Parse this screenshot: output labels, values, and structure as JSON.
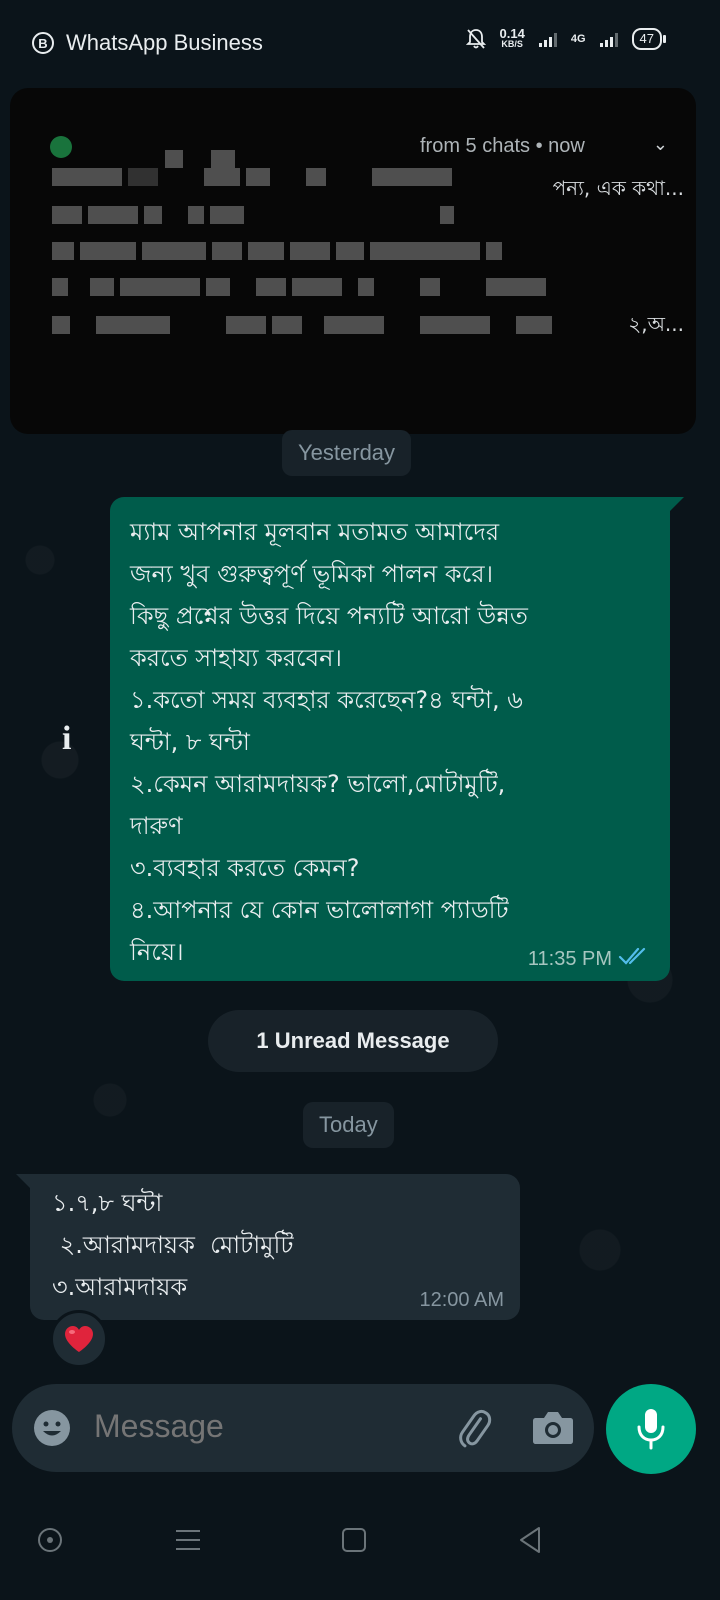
{
  "status_bar": {
    "app_name": "WhatsApp Business",
    "app_badge": "B",
    "speed_value": "0.14",
    "speed_unit": "KB/S",
    "network_label": "4G",
    "battery": "47"
  },
  "notification": {
    "meta": "from 5 chats • now",
    "line1_tail": "পন্য, এক কথা...",
    "line2_tail": "২,অ..."
  },
  "chat": {
    "date_yesterday": "Yesterday",
    "outgoing_message": {
      "text": "ম্যাম আপনার মূলবান মতামত আমাদের\nজন্য খুব গুরুত্বপূর্ণ ভূমিকা পালন করে।\nকিছু প্রশ্নের উত্তর দিয়ে পন্যটি আরো উন্নত\nকরতে সাহায্য করবেন।\n১.কতো সময় ব্যবহার করেছেন?৪ ঘন্টা, ৬\nঘন্টা, ৮ ঘন্টা\n২.কেমন আরামদায়ক? ভালো,মোটামুটি,\nদারুণ\n৩.ব্যবহার করতে কেমন?\n৪.আপনার যে কোন ভালোলাগা প্যাডটি\nনিয়ে।",
      "time": "11:35 PM",
      "status": "read"
    },
    "info_icon": "i",
    "unread_label": "1 Unread Message",
    "date_today": "Today",
    "incoming_message": {
      "text": "১.৭,৮ ঘন্টা\n ২.আরামদায়ক  মোটামুটি\n৩.আরামদায়ক",
      "time": "12:00 AM",
      "reaction": "heart"
    }
  },
  "composer": {
    "placeholder": "Message",
    "icons": [
      "emoji-icon",
      "paperclip-icon",
      "camera-icon",
      "mic-icon"
    ]
  },
  "nav_bar": {
    "icons": [
      "circle-icon",
      "menu-icon",
      "square-icon",
      "back-triangle-icon"
    ]
  },
  "colors": {
    "background": "#0b141a",
    "outgoing_bubble": "#005c4b",
    "incoming_bubble": "#1f2c34",
    "accent": "#00a884",
    "read_ticks": "#53bdeb"
  }
}
